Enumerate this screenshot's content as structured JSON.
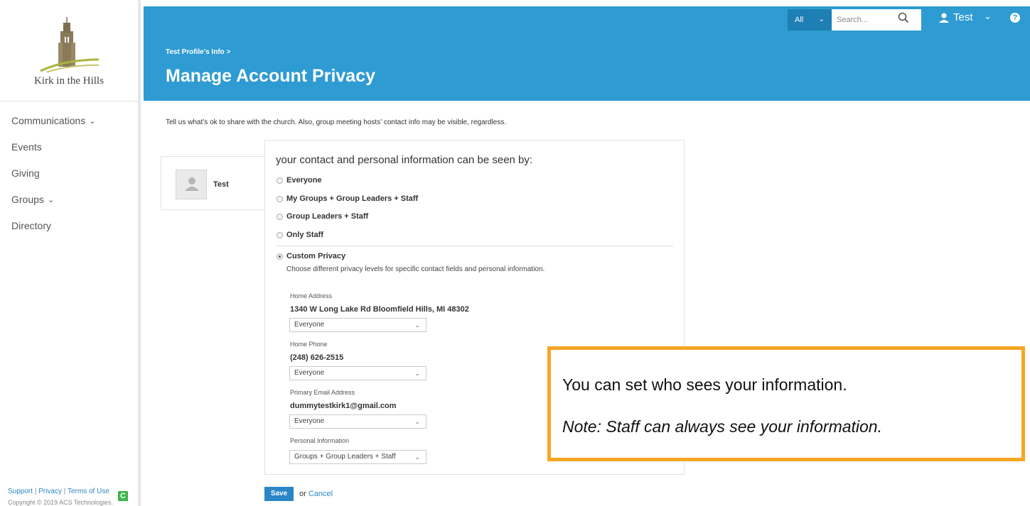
{
  "sidebar": {
    "logo_text": "Kirk in the Hills",
    "items": [
      {
        "label": "Communications",
        "chevron": true
      },
      {
        "label": "Events",
        "chevron": false
      },
      {
        "label": "Giving",
        "chevron": false
      },
      {
        "label": "Groups",
        "chevron": true
      },
      {
        "label": "Directory",
        "chevron": false
      }
    ],
    "footer": {
      "support": "Support",
      "sep": "|",
      "privacy": "Privacy",
      "terms": "Terms of Use",
      "copyright": "Copyright © 2019 ACS Technologies.",
      "badge": "C"
    }
  },
  "header": {
    "breadcrumb": "Test Profile's Info >",
    "title": "Manage Account Privacy",
    "search_scope": "All",
    "search_placeholder": "Search...",
    "user_name": "Test",
    "help": "?"
  },
  "main": {
    "intro": "Tell us what’s ok to share with the church. Also, group meeting hosts’ contact info may be visible, regardless.",
    "profile_name": "Test",
    "panel_title": "your contact and personal information can be seen by:",
    "options": [
      {
        "label": "Everyone",
        "selected": false
      },
      {
        "label": "My Groups + Group Leaders + Staff",
        "selected": false
      },
      {
        "label": "Group Leaders + Staff",
        "selected": false
      },
      {
        "label": "Only Staff",
        "selected": false
      },
      {
        "label": "Custom Privacy",
        "selected": true
      }
    ],
    "custom_desc": "Choose different privacy levels for specific contact fields and personal information.",
    "fields": [
      {
        "label": "Home Address",
        "value": "1340 W Long Lake Rd Bloomfield Hills, MI 48302",
        "select": "Everyone"
      },
      {
        "label": "Home Phone",
        "value": "(248) 626-2515",
        "select": "Everyone"
      },
      {
        "label": "Primary Email Address",
        "value": "dummytestkirk1@gmail.com",
        "select": "Everyone"
      },
      {
        "label": "Personal Information",
        "value": "",
        "select": "Groups + Group Leaders + Staff"
      }
    ],
    "save_label": "Save",
    "or_text": "or",
    "cancel_label": "Cancel"
  },
  "callout": {
    "line1": "You can set who sees your information.",
    "line2": "Note: Staff can always see your information."
  },
  "colors": {
    "header_bg": "#2e9bd2",
    "link": "#2a86c6",
    "callout_border": "#f5a623",
    "badge": "#3db54a"
  }
}
